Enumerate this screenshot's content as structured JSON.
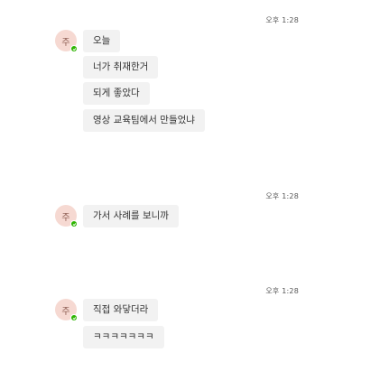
{
  "groups": [
    {
      "time": "오후 1:28",
      "avatar_initial": "주",
      "messages": [
        "오늘",
        "너가 취재한거",
        "되게 좋았다",
        "영상 교육팀에서 만들었냐"
      ]
    },
    {
      "time": "오후 1:28",
      "avatar_initial": "주",
      "messages": [
        "가서 사례를 보니까"
      ]
    },
    {
      "time": "오후 1:28",
      "avatar_initial": "주",
      "messages": [
        "직접 와닿더라",
        "ㅋㅋㅋㅋㅋㅋㅋ"
      ]
    }
  ],
  "colors": {
    "bubble": "#f2f2f2",
    "avatar_bg": "#f6d9d2",
    "online": "#2db400"
  }
}
